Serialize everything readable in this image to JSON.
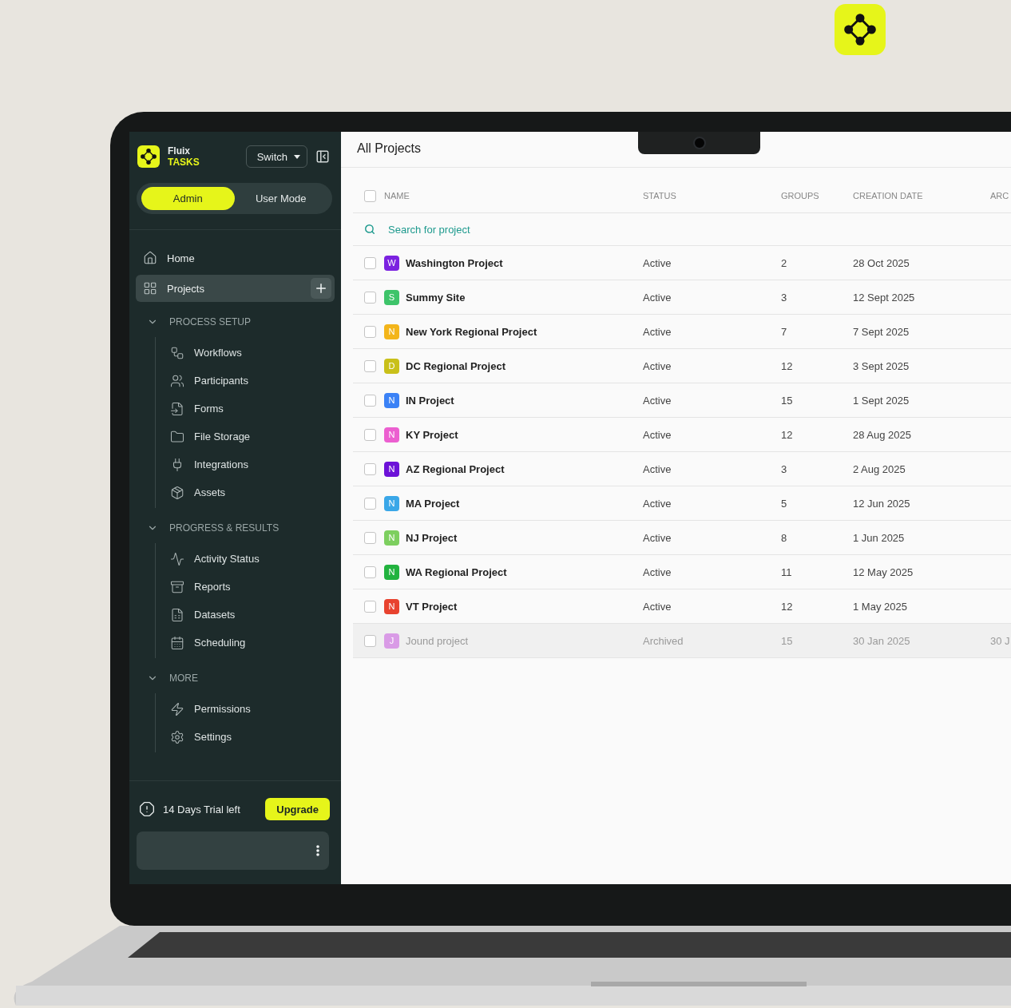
{
  "brand": {
    "name": "Fluix",
    "product": "TASKS"
  },
  "switch_button": "Switch",
  "mode_toggle": [
    {
      "label": "Admin",
      "selected": true
    },
    {
      "label": "User Mode",
      "selected": false
    }
  ],
  "nav": [
    {
      "label": "Home",
      "selected": false
    },
    {
      "label": "Projects",
      "selected": true
    }
  ],
  "sections": [
    {
      "title": "PROCESS SETUP",
      "expanded": true,
      "items": [
        "Workflows",
        "Participants",
        "Forms",
        "File Storage",
        "Integrations",
        "Assets"
      ]
    },
    {
      "title": "PROGRESS & RESULTS",
      "expanded": true,
      "items": [
        "Activity Status",
        "Reports",
        "Datasets",
        "Scheduling"
      ]
    },
    {
      "title": "MORE",
      "expanded": true,
      "items": [
        "Permissions",
        "Settings"
      ]
    }
  ],
  "trial": {
    "text": "14 Days Trial left",
    "button": "Upgrade"
  },
  "page_title": "All Projects",
  "table": {
    "header_checked": false,
    "columns": [
      "NAME",
      "STATUS",
      "GROUPS",
      "CREATION DATE",
      "ARC"
    ],
    "search_placeholder": "Search for project",
    "rows": [
      {
        "initial": "W",
        "color": "#7b22e0",
        "name": "Washington Project",
        "status": "Active",
        "groups": "2",
        "date": "28 Oct 2025",
        "checked": false,
        "archived": false
      },
      {
        "initial": "S",
        "color": "#3ec46a",
        "name": "Summy Site",
        "status": "Active",
        "groups": "3",
        "date": "12 Sept 2025",
        "checked": false,
        "archived": false
      },
      {
        "initial": "N",
        "color": "#f3b51a",
        "name": "New York Regional Project",
        "status": "Active",
        "groups": "7",
        "date": "7 Sept 2025",
        "checked": false,
        "archived": false
      },
      {
        "initial": "D",
        "color": "#c9c01a",
        "name": "DC Regional Project",
        "status": "Active",
        "groups": "12",
        "date": "3 Sept 2025",
        "checked": false,
        "archived": false
      },
      {
        "initial": "N",
        "color": "#3b82f6",
        "name": "IN Project",
        "status": "Active",
        "groups": "15",
        "date": "1 Sept 2025",
        "checked": false,
        "archived": false
      },
      {
        "initial": "N",
        "color": "#ec5fd0",
        "name": "KY Project",
        "status": "Active",
        "groups": "12",
        "date": "28 Aug 2025",
        "checked": false,
        "archived": false
      },
      {
        "initial": "N",
        "color": "#6d12d8",
        "name": "AZ Regional Project",
        "status": "Active",
        "groups": "3",
        "date": "2 Aug 2025",
        "checked": false,
        "archived": false
      },
      {
        "initial": "N",
        "color": "#3aa7e8",
        "name": "MA Project",
        "status": "Active",
        "groups": "5",
        "date": "12 Jun 2025",
        "checked": false,
        "archived": false
      },
      {
        "initial": "N",
        "color": "#7dcf5f",
        "name": "NJ Project",
        "status": "Active",
        "groups": "8",
        "date": "1 Jun 2025",
        "checked": false,
        "archived": false
      },
      {
        "initial": "N",
        "color": "#22b33f",
        "name": "WA Regional Project",
        "status": "Active",
        "groups": "11",
        "date": "12 May 2025",
        "checked": false,
        "archived": false
      },
      {
        "initial": "N",
        "color": "#e8432f",
        "name": "VT Project",
        "status": "Active",
        "groups": "12",
        "date": "1 May 2025",
        "checked": false,
        "archived": false
      },
      {
        "initial": "J",
        "color": "#d99be6",
        "name": "Jound project",
        "status": "Archived",
        "groups": "15",
        "date": "30 Jan 2025",
        "column_5": "30 J",
        "checked": false,
        "archived": true
      }
    ]
  }
}
